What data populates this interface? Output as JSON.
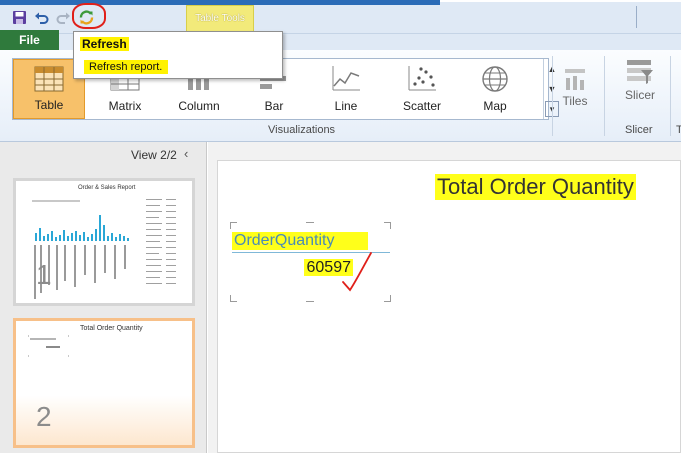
{
  "titlebar": {
    "context_tab_label": "Table Tools",
    "icons": [
      "save-icon",
      "undo-icon",
      "redo-icon",
      "refresh-icon"
    ]
  },
  "file_tab": {
    "label": "File"
  },
  "ribbon": {
    "visualizations": [
      {
        "label": "Table",
        "icon": "table-icon",
        "selected": true
      },
      {
        "label": "Matrix",
        "icon": "matrix-icon",
        "selected": false
      },
      {
        "label": "Column",
        "icon": "column-chart-icon",
        "selected": false
      },
      {
        "label": "Bar",
        "icon": "bar-chart-icon",
        "selected": false
      },
      {
        "label": "Line",
        "icon": "line-chart-icon",
        "selected": false
      },
      {
        "label": "Scatter",
        "icon": "scatter-chart-icon",
        "selected": false
      },
      {
        "label": "Map",
        "icon": "globe-icon",
        "selected": false
      }
    ],
    "visualizations_group_label": "Visualizations",
    "tiles_label": "Tiles",
    "slicer_label": "Slicer",
    "slicer_group_label": "Slicer",
    "next_group_label": "T"
  },
  "tooltip": {
    "title": "Refresh",
    "description": "Refresh report."
  },
  "views_pane": {
    "view_label": "View",
    "view_counter": "2/2",
    "thumbnails": [
      {
        "number": "1",
        "title": "Order & Sales Report"
      },
      {
        "number": "2",
        "title": "Total Order Quantity"
      }
    ]
  },
  "canvas": {
    "title": "Total Order Quantity",
    "table": {
      "column_header": "OrderQuantity",
      "value": "60597"
    }
  },
  "colors": {
    "file_tab": "#2f7a3c",
    "highlight": "#ffff1a",
    "selected_button": "#f7c16a",
    "annotation_red": "#e0201a"
  }
}
